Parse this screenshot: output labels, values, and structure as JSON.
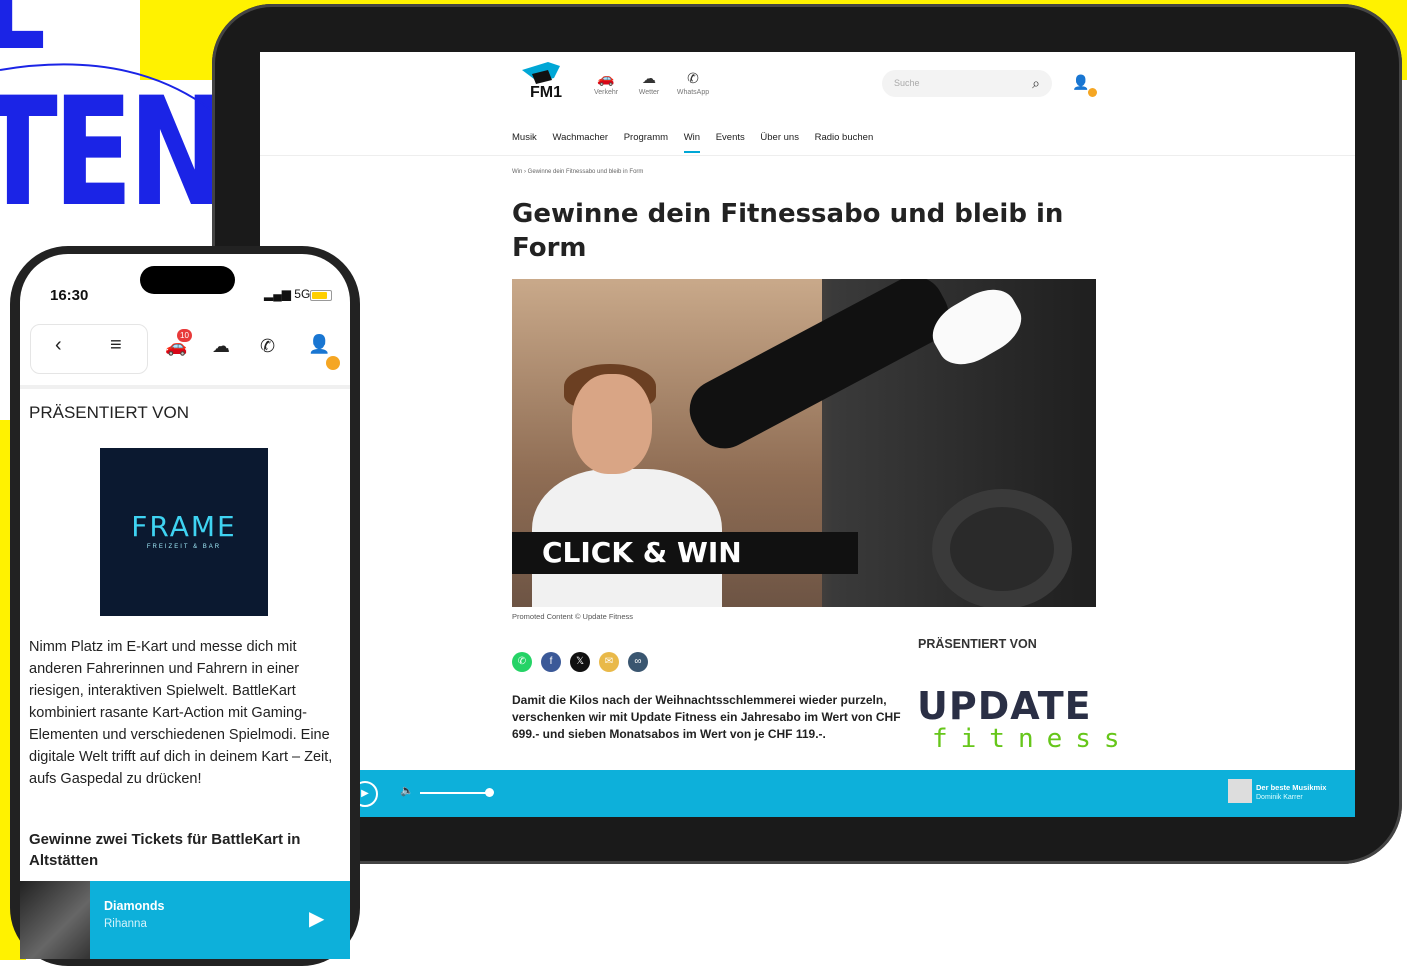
{
  "backdrop": {
    "text_line1": "L",
    "text_line2": "TENT"
  },
  "tablet": {
    "logo": "FM1",
    "nav_icons": [
      {
        "name": "Verkehr",
        "icon": "car-icon"
      },
      {
        "name": "Wetter",
        "icon": "weather-icon"
      },
      {
        "name": "WhatsApp",
        "icon": "whatsapp-icon"
      }
    ],
    "search_placeholder": "Suche",
    "menu": [
      "Musik",
      "Wachmacher",
      "Programm",
      "Win",
      "Events",
      "Über uns",
      "Radio buchen"
    ],
    "menu_active": "Win",
    "breadcrumb": "Win  ›  Gewinne dein Fitnessabo und bleib in Form",
    "title": "Gewinne dein Fitnessabo und bleib in Form",
    "hero_overlay": "CLICK & WIN",
    "promo_caption": "Promoted Content © Update Fitness",
    "share_colors": [
      "#25d366",
      "#3b5998",
      "#111111",
      "#e9b949",
      "#3a5670"
    ],
    "body": "Damit die Kilos nach der Weihnachtsschlemmerei wieder purzeln, verschenken wir mit Update Fitness ein Jahresabo im Wert von CHF 699.- und sieben Monatsabos im Wert von je CHF 119.-.",
    "presented_by": "PRÄSENTIERT VON",
    "sponsor_top": "UPDATE",
    "sponsor_bottom": "fitness",
    "player": {
      "now_playing_title": "Der beste Musikmix",
      "now_playing_sub": "Dominik Karrer"
    },
    "accent_color": "#0db0da"
  },
  "phone": {
    "time": "16:30",
    "network": "5G",
    "traffic_badge": "10",
    "presented_by": "PRÄSENTIERT VON",
    "frame_logo": "FRAME",
    "frame_sub": "FREIZEIT & BAR",
    "body": "Nimm Platz im E-Kart und messe dich mit anderen Fahrerinnen und Fahrern in einer riesigen, interaktiven Spielwelt. BattleKart kombiniert rasante Kart-Action mit Gaming-Elementen und verschiedenen Spielmodi. Eine digitale Welt trifft auf dich in deinem Kart – Zeit, aufs Gaspedal zu drücken!",
    "heading": "Gewinne zwei Tickets für BattleKart in Altstätten",
    "player": {
      "song": "Diamonds",
      "artist": "Rihanna"
    }
  }
}
